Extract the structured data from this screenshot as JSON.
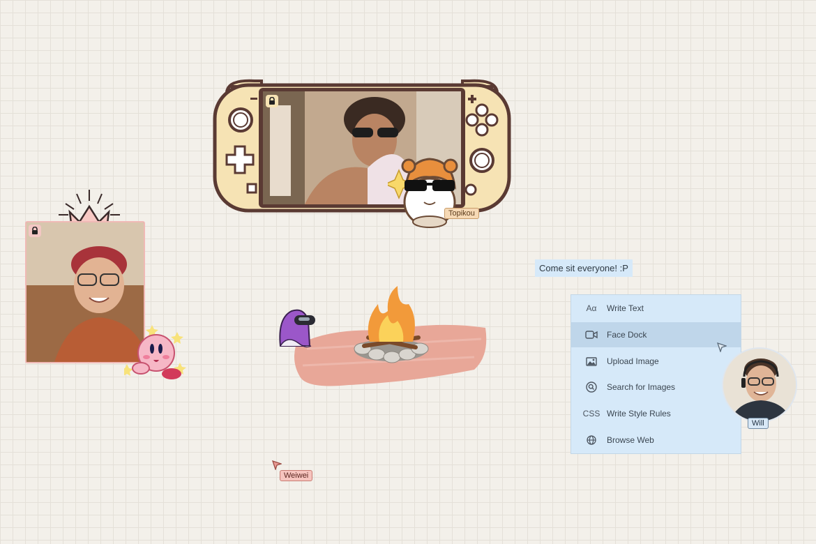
{
  "console": {
    "lock_icon": "lock-icon"
  },
  "left_cam": {
    "lock_icon": "lock-icon"
  },
  "hamster": {
    "name_tag": "Topikou"
  },
  "chat": {
    "text": "Come sit everyone! :P"
  },
  "menu": {
    "items": [
      {
        "icon": "text-icon",
        "icon_glyph": "Aα",
        "label": "Write Text",
        "active": false
      },
      {
        "icon": "video-icon",
        "icon_glyph": "",
        "label": "Face Dock",
        "active": true
      },
      {
        "icon": "image-icon",
        "icon_glyph": "",
        "label": "Upload Image",
        "active": false
      },
      {
        "icon": "search-icon",
        "icon_glyph": "",
        "label": "Search for Images",
        "active": false
      },
      {
        "icon": "css-icon",
        "icon_glyph": "CSS",
        "label": "Write Style Rules",
        "active": false
      },
      {
        "icon": "globe-icon",
        "icon_glyph": "",
        "label": "Browse Web",
        "active": false
      }
    ]
  },
  "cursors": {
    "weiwei": {
      "name": "Weiwei",
      "color": "#e89a93"
    },
    "will": {
      "name": "Will",
      "color": "#dfe9f2"
    }
  },
  "colors": {
    "console_body": "#f6e3b4",
    "console_outline": "#5a3a33",
    "menu_bg": "#d6e9f9",
    "menu_active": "#bfd6ea",
    "brush_stroke": "#e8a798"
  }
}
